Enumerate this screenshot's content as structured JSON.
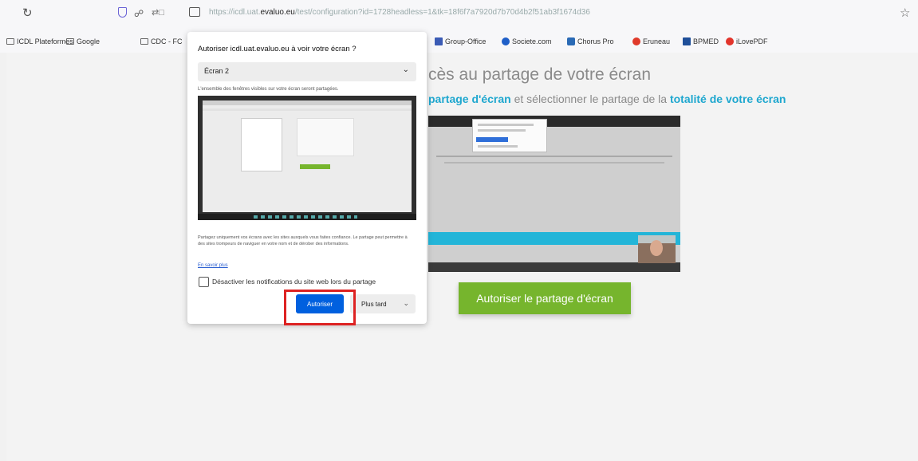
{
  "browser": {
    "url_prefix": "https://icdl.uat.",
    "url_domain": "evaluo.eu",
    "url_path": "/test/configuration?id=1728headless=1&tk=18f6f7a7920d7b70d4b2f51ab3f1674d36"
  },
  "bookmarks": [
    {
      "label": "ICDL Plateformes"
    },
    {
      "label": "Google"
    },
    {
      "label": "CDC - FC"
    },
    {
      "label": "Group-Office"
    },
    {
      "label": "Societe.com"
    },
    {
      "label": "Chorus Pro"
    },
    {
      "label": "Eruneau"
    },
    {
      "label": "BPMED"
    },
    {
      "label": "iLovePDF"
    }
  ],
  "page": {
    "heading": "cès au partage de votre écran",
    "instruction_part1": "partage d'écran",
    "instruction_part2": " et sélectionner le partage de la ",
    "instruction_part3": "totalité de votre écran",
    "share_button": "Autoriser le partage d'écran"
  },
  "dialog": {
    "title": "Autoriser icdl.uat.evaluo.eu à voir votre écran ?",
    "select_value": "Écran 2",
    "select_note": "L'ensemble des fenêtres visibles sur votre écran seront partagées.",
    "warning": "Partagez uniquement vos écrans avec les sites auxquels vous faites confiance. Le partage peut permettre à des sites trompeurs de naviguer en votre nom et de dérober des informations.",
    "learn_more": "En savoir plus",
    "checkbox_label": "Désactiver les notifications du site web lors du partage",
    "allow_button": "Autoriser",
    "later_button": "Plus tard"
  },
  "colors": {
    "accent_blue": "#1ea7cf",
    "primary_button": "#0060df",
    "share_green": "#76b52d",
    "highlight_red": "#dd2222"
  }
}
